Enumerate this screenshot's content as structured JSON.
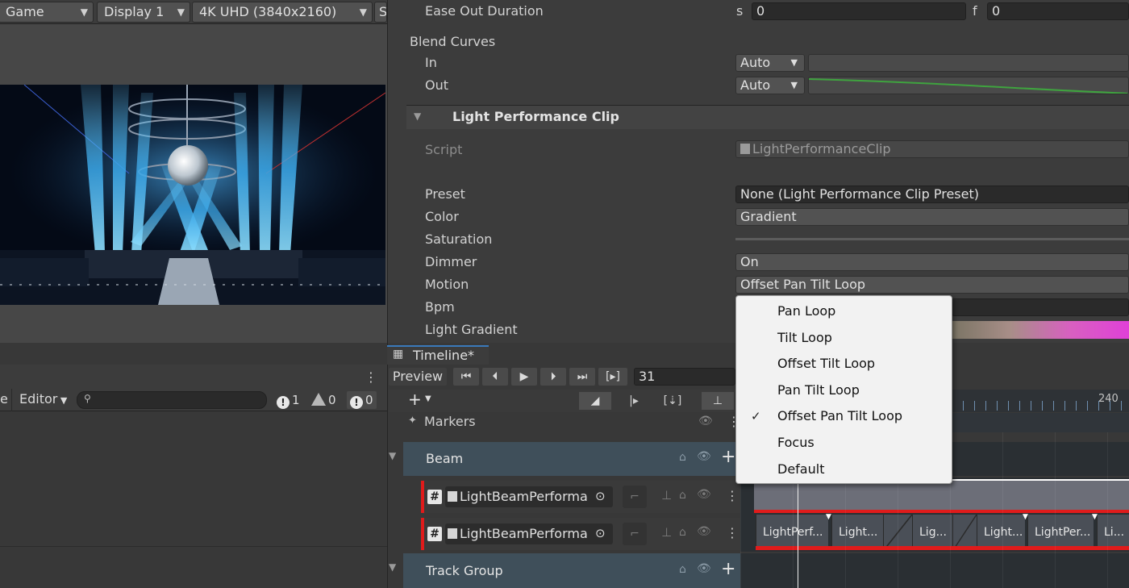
{
  "game_toolbar": {
    "view_dropdown": "Game",
    "display_dropdown": "Display 1",
    "resolution_dropdown": "4K UHD (3840x2160)",
    "scale_truncated": "S"
  },
  "console": {
    "mode_truncated": "e",
    "editor_dropdown": "Editor",
    "search_placeholder": "",
    "error_count": "1",
    "warning_count": "0",
    "info_count": "0"
  },
  "inspector": {
    "ease_out": {
      "label": "Ease Out Duration",
      "s_label": "s",
      "s_value": "0",
      "f_label": "f",
      "f_value": "0"
    },
    "blend_curves": {
      "label": "Blend Curves",
      "in_label": "In",
      "in_value": "Auto",
      "out_label": "Out",
      "out_value": "Auto"
    },
    "clip_header": "Light Performance Clip",
    "script_label": "Script",
    "script_value": "LightPerformanceClip",
    "preset_label": "Preset",
    "preset_value": "None (Light Performance Clip Preset)",
    "color_label": "Color",
    "color_value": "Gradient",
    "saturation_label": "Saturation",
    "dimmer_label": "Dimmer",
    "dimmer_value": "On",
    "motion_label": "Motion",
    "motion_value": "Offset Pan Tilt Loop",
    "bpm_label": "Bpm",
    "gradient_label": "Light Gradient",
    "gradient_colors": [
      "#7a7464",
      "#a88e88",
      "#d860c0",
      "#e040d8"
    ]
  },
  "motion_menu": {
    "items": [
      {
        "label": "Pan Loop",
        "checked": false
      },
      {
        "label": "Tilt Loop",
        "checked": false
      },
      {
        "label": "Offset Tilt Loop",
        "checked": false
      },
      {
        "label": "Pan Tilt Loop",
        "checked": false
      },
      {
        "label": "Offset Pan Tilt Loop",
        "checked": true
      },
      {
        "label": "Focus",
        "checked": false
      },
      {
        "label": "Default",
        "checked": false
      }
    ],
    "check_glyph": "✓"
  },
  "timeline": {
    "tab_label": "Timeline*",
    "preview_label": "Preview",
    "frame_value": "31",
    "ruler_label": "240",
    "markers_label": "Markers",
    "beam_group": "Beam",
    "track1_label": "LightBeamPerforma",
    "track2_label": "LightBeamPerforma",
    "track_group_label": "Track Group",
    "clips": [
      "LightPerf...",
      "Light...",
      "Lig...",
      "Light...",
      "LightPer...",
      "Li..."
    ]
  },
  "colors": {
    "track_accent": "#e01b1b",
    "curve_green": "#3fa33f",
    "beam_blue": "#3aa7e8"
  }
}
